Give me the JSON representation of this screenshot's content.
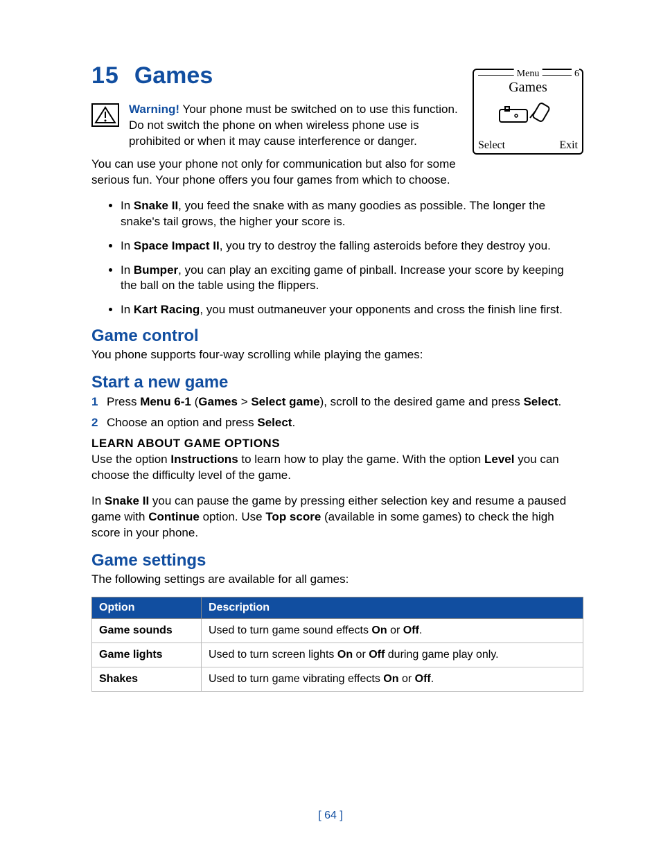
{
  "chapter": {
    "number": "15",
    "title": "Games"
  },
  "warning": {
    "label": "Warning!",
    "text": " Your phone must be switched on to use this function. Do not switch the phone on when wireless phone use is prohibited or when it may cause interference or danger."
  },
  "phone_screen": {
    "menu_label": "Menu",
    "menu_number": "6",
    "title": "Games",
    "left_softkey": "Select",
    "right_softkey": "Exit"
  },
  "intro": "You can use your phone not only for communication but also for some serious fun. Your phone offers you four games from which to choose.",
  "bullets": [
    {
      "prefix": "In ",
      "bold": "Snake II",
      "suffix": ", you feed the snake with as many goodies as possible. The longer the snake's tail grows, the higher your score is."
    },
    {
      "prefix": "In ",
      "bold": "Space Impact II",
      "suffix": ", you try to destroy the falling asteroids before they destroy you."
    },
    {
      "prefix": "In ",
      "bold": "Bumper",
      "suffix": ", you can play an exciting game of pinball. Increase your score by keeping the ball on the table using the flippers."
    },
    {
      "prefix": "In ",
      "bold": "Kart Racing",
      "suffix": ", you must outmaneuver your opponents and cross the finish line first."
    }
  ],
  "game_control": {
    "heading": "Game control",
    "text": "You phone supports four-way scrolling while playing the games:"
  },
  "start_game": {
    "heading": "Start a new game",
    "steps": [
      {
        "n": "1",
        "pre": "Press ",
        "b1": "Menu 6-1",
        "mid1": " (",
        "b2": "Games",
        "mid2": " > ",
        "b3": "Select game",
        "mid3": "), scroll to the desired game and press ",
        "b4": "Select",
        "post": "."
      },
      {
        "n": "2",
        "pre": "Choose an option and press ",
        "b1": "Select",
        "post": "."
      }
    ]
  },
  "learn_options": {
    "heading": "LEARN ABOUT GAME OPTIONS",
    "p1": {
      "pre": "Use the option ",
      "b1": "Instructions",
      "mid": " to learn how to play the game. With the option ",
      "b2": "Level",
      "post": " you can choose the difficulty level of the game."
    },
    "p2": {
      "pre": "In ",
      "b1": "Snake II",
      "mid1": " you can pause the game by pressing either selection key and resume a paused game with ",
      "b2": "Continue",
      "mid2": " option. Use ",
      "b3": "Top score",
      "post": " (available in some games) to check the high score in your phone."
    }
  },
  "game_settings": {
    "heading": "Game settings",
    "intro": "The following settings are available for all games:",
    "headers": {
      "option": "Option",
      "description": "Description"
    },
    "rows": [
      {
        "option": "Game sounds",
        "pre": "Used to turn game sound effects ",
        "b1": "On",
        "mid": " or ",
        "b2": "Off",
        "post": "."
      },
      {
        "option": "Game lights",
        "pre": "Used to turn screen lights ",
        "b1": "On",
        "mid": " or ",
        "b2": "Off",
        "post": " during game play only."
      },
      {
        "option": "Shakes",
        "pre": "Used to turn game vibrating effects ",
        "b1": "On",
        "mid": " or ",
        "b2": "Off",
        "post": "."
      }
    ]
  },
  "page_number": "[ 64 ]"
}
